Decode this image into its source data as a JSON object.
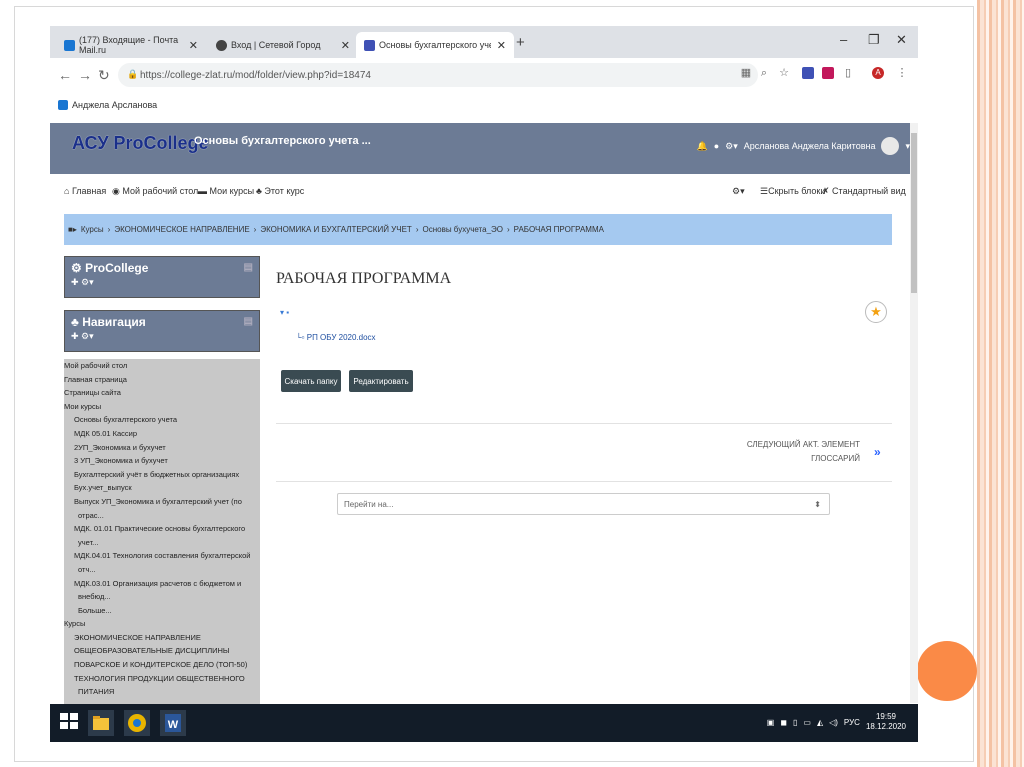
{
  "browser": {
    "tabs": [
      {
        "label": "(177) Входящие - Почта Mail.ru",
        "color": "#1976d2"
      },
      {
        "label": "Вход | Сетевой Город",
        "color": "#444444"
      },
      {
        "label": "Основы бухгалтерского учета_ЭО: РАБОЧАЯ П",
        "color": "#3f51b5"
      }
    ],
    "url": "https://college-zlat.ru/mod/folder/view.php?id=18474",
    "bookmark": "Анджела Арсланова"
  },
  "site": {
    "brand": "АСУ ProCollege",
    "course_title": "Основы бухгалтерского учета ...",
    "user_name": "Арсланова Анджела Каритовна",
    "toolbar": {
      "home": "Главная",
      "dashboard": "Мой рабочий стол",
      "my_courses": "Мои курсы",
      "this_course": "Этот курс",
      "hide_blocks": "Скрыть блоки",
      "standard_view": "Стандартный вид"
    },
    "breadcrumb": [
      "Курсы",
      "ЭКОНОМИЧЕСКОЕ НАПРАВЛЕНИЕ",
      "ЭКОНОМИКА И БУХГАЛТЕРСКИЙ УЧЕТ",
      "Основы бухучета_ЭО",
      "РАБОЧАЯ ПРОГРАММА"
    ]
  },
  "blocks": {
    "procollege": "ProCollege",
    "navigation": "Навигация"
  },
  "navtree": [
    {
      "label": "Мой рабочий стол",
      "level": 0
    },
    {
      "label": "Главная страница",
      "level": 0
    },
    {
      "label": "Страницы сайта",
      "level": 0
    },
    {
      "label": "Мои курсы",
      "level": 0
    },
    {
      "label": "Основы бухгалтерского учета",
      "level": 1
    },
    {
      "label": "МДК 05.01 Кассир",
      "level": 1
    },
    {
      "label": "2УП_Экономика и бухучет",
      "level": 1
    },
    {
      "label": "3 УП_Экономика и бухучет",
      "level": 1
    },
    {
      "label": "Бухгалтерский учёт в бюджетных организациях",
      "level": 1
    },
    {
      "label": "Бух.учет_выпуск",
      "level": 1
    },
    {
      "label": "Выпуск УП_Экономика и бухгалтерский учет (по",
      "level": 1
    },
    {
      "label": "отрас...",
      "level": 2
    },
    {
      "label": "МДК. 01.01 Практические основы бухгалтерского",
      "level": 1
    },
    {
      "label": "учет...",
      "level": 2
    },
    {
      "label": "МДК.04.01 Технология составления бухгалтерской",
      "level": 1
    },
    {
      "label": "отч...",
      "level": 2
    },
    {
      "label": "МДК.03.01 Организация расчетов с бюджетом и",
      "level": 1
    },
    {
      "label": "внебюд...",
      "level": 2
    },
    {
      "label": "Больше...",
      "level": 2
    },
    {
      "label": "Курсы",
      "level": 0
    },
    {
      "label": "ЭКОНОМИЧЕСКОЕ НАПРАВЛЕНИЕ",
      "level": 1
    },
    {
      "label": "ОБЩЕОБРАЗОВАТЕЛЬНЫЕ ДИСЦИПЛИНЫ",
      "level": 1
    },
    {
      "label": "ПОВАРСКОЕ И КОНДИТЕРСКОЕ ДЕЛО (ТОП-50)",
      "level": 1
    },
    {
      "label": "ТЕХНОЛОГИЯ ПРОДУКЦИИ ОБЩЕСТВЕННОГО",
      "level": 1
    },
    {
      "label": "ПИТАНИЯ",
      "level": 2
    }
  ],
  "main": {
    "title": "РАБОЧАЯ ПРОГРАММА",
    "file_name": "РП ОБУ 2020.docx",
    "download_button": "Скачать папку",
    "edit_button": "Редактировать",
    "next_activity_line1": "СЛЕДУЮЩИЙ АКТ. ЭЛЕМЕНТ",
    "next_activity_line2": "ГЛОССАРИЙ",
    "jump_placeholder": "Перейти на..."
  },
  "taskbar": {
    "lang": "РУС",
    "time": "19:59",
    "date": "18.12.2020"
  }
}
